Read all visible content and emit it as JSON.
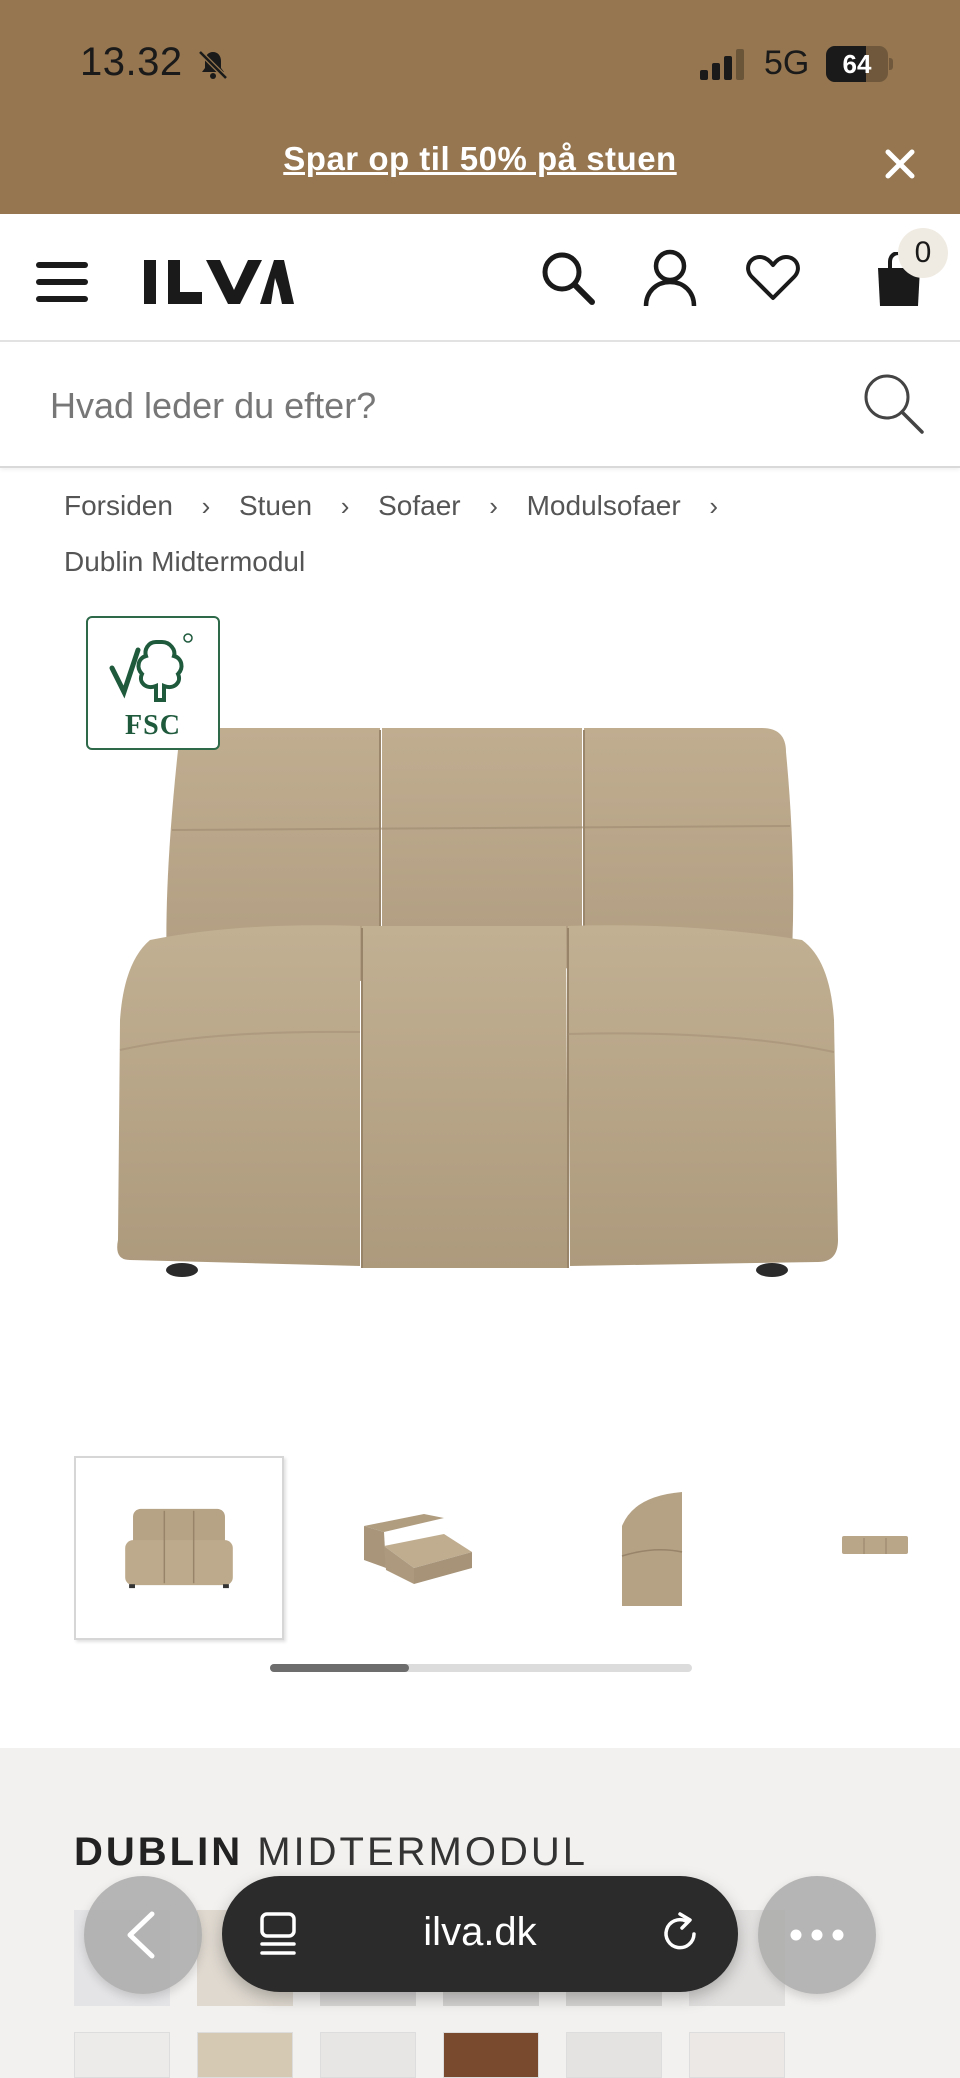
{
  "status_bar": {
    "time": "13.32",
    "network": "5G",
    "battery_level": 64,
    "battery_label": "64"
  },
  "promo": {
    "text": "Spar op til 50% på stuen",
    "background": "#957650"
  },
  "header": {
    "logo": "ILVA",
    "cart_count": "0",
    "icons": [
      "menu-icon",
      "search-icon",
      "account-icon",
      "heart-icon",
      "bag-icon"
    ]
  },
  "search": {
    "placeholder": "Hvad leder du efter?"
  },
  "breadcrumb": {
    "items": [
      "Forsiden",
      "Stuen",
      "Sofaer",
      "Modulsofaer"
    ],
    "separator": "›",
    "current": "Dublin Midtermodul"
  },
  "badge": {
    "label": "FSC"
  },
  "gallery": {
    "thumbnail_count": 4,
    "active_index": 0,
    "scroll_fraction": 0.33
  },
  "product": {
    "brand": "DUBLIN",
    "name": "MIDTERMODUL"
  },
  "browser": {
    "url": "ilva.dk"
  },
  "colors": {
    "fabric": "#b8a68a",
    "fsc_green": "#1f5a3d"
  }
}
